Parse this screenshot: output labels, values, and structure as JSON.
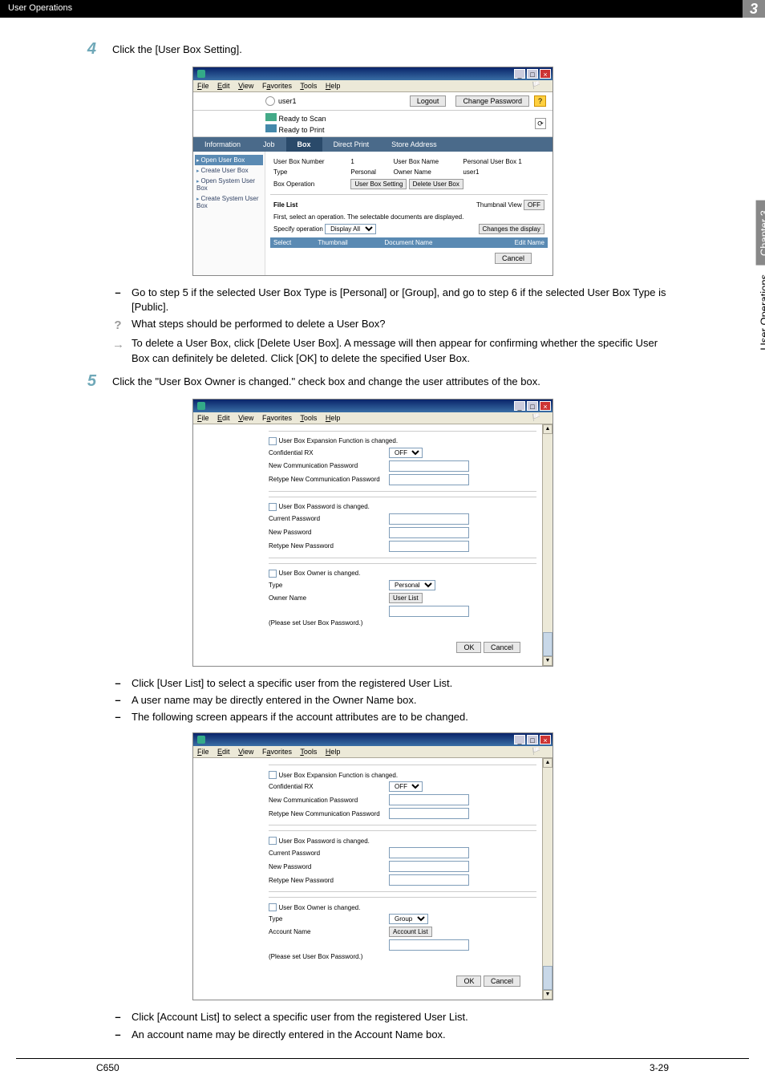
{
  "header": {
    "title": "User Operations",
    "chapter_num": "3"
  },
  "sidebar": {
    "text": "User Operations",
    "chapter": "Chapter 3"
  },
  "step4": {
    "num": "4",
    "text": "Click the [User Box Setting]."
  },
  "ss1": {
    "menus": [
      "File",
      "Edit",
      "View",
      "Favorites",
      "Tools",
      "Help"
    ],
    "user": "user1",
    "logout": "Logout",
    "change_pw": "Change Password",
    "help": "?",
    "ready_scan": "Ready to Scan",
    "ready_print": "Ready to Print",
    "tabs": [
      "Information",
      "Job",
      "Box",
      "Direct Print",
      "Store Address"
    ],
    "side_items": [
      "Open User Box",
      "Create User Box",
      "Open System User Box",
      "Create System User Box"
    ],
    "detail": {
      "ubn_label": "User Box Number",
      "ubn_val": "1",
      "ubname_label": "User Box Name",
      "ubname_val": "Personal User Box 1",
      "type_label": "Type",
      "type_val": "Personal",
      "owner_label": "Owner Name",
      "owner_val": "user1",
      "op_label": "Box Operation",
      "btn_setting": "User Box Setting",
      "btn_delete": "Delete User Box",
      "filelist": "File List",
      "thumb_label": "Thumbnail View",
      "thumb_btn": "OFF",
      "instr": "First, select an operation. The selectable documents are displayed.",
      "spec_label": "Specify operation",
      "spec_val": "Display All",
      "changes_btn": "Changes the display",
      "th_sel": "Select",
      "th_thumb": "Thumbnail",
      "th_doc": "Document Name",
      "th_edit": "Edit Name",
      "cancel": "Cancel"
    }
  },
  "sub4": {
    "a": "Go to step 5 if the selected User Box Type is [Personal] or [Group], and go to step 6 if the selected User Box Type is [Public].",
    "q": "What steps should be performed to delete a User Box?",
    "arr": "To delete a User Box, click [Delete User Box]. A message will then appear for confirming whether the specific User Box can definitely be deleted. Click [OK] to delete the specified User Box."
  },
  "step5": {
    "num": "5",
    "text": "Click the \"User Box Owner is changed.\" check box and change the user attributes of the box."
  },
  "ss2": {
    "g1_chk": "User Box Expansion Function is changed.",
    "g1_conf": "Confidential RX",
    "g1_off": "OFF",
    "g1_newcomm": "New Communication Password",
    "g1_retype": "Retype New Communication Password",
    "g2_chk": "User Box Password is changed.",
    "g2_cur": "Current Password",
    "g2_new": "New Password",
    "g2_re": "Retype New Password",
    "g3_chk": "User Box Owner is changed.",
    "g3_type": "Type",
    "g3_type_val": "Personal",
    "g3_owner": "Owner Name",
    "g3_btn": "User List",
    "g3_note": "(Please set User Box Password.)",
    "ok": "OK",
    "cancel": "Cancel"
  },
  "sub5": {
    "a": "Click [User List] to select a specific user from the registered User List.",
    "b": "A user name may be directly entered in the Owner Name box.",
    "c": "The following screen appears if the account attributes are to be changed."
  },
  "ss3": {
    "g3_type_val": "Group",
    "g3_acct": "Account Name",
    "g3_btn": "Account List"
  },
  "sub6": {
    "a": "Click [Account List] to select a specific user from the registered User List.",
    "b": "An account name may be directly entered in the Account Name box."
  },
  "footer": {
    "left": "C650",
    "right": "3-29"
  }
}
